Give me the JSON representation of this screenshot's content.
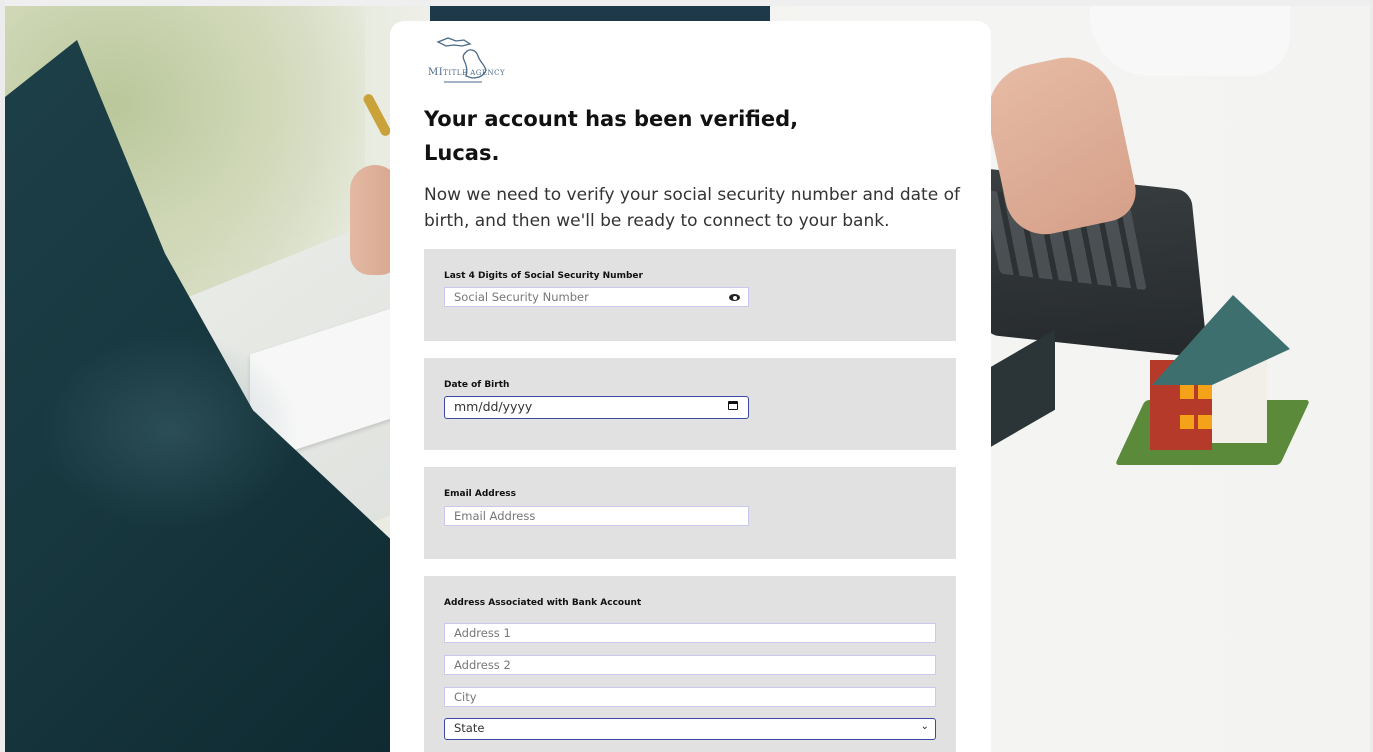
{
  "logo": {
    "name_main": "MI",
    "name_rest": "TITLE AGENCY"
  },
  "heading": {
    "line1": "Your account has been verified,",
    "line2": "Lucas."
  },
  "subtitle": "Now we need to verify your social security number and date of birth, and then we'll be ready to connect to your bank.",
  "ssn": {
    "label": "Last 4 Digits of Social Security Number",
    "placeholder": "Social Security Number",
    "toggle_icon": "eye-icon"
  },
  "dob": {
    "label": "Date of Birth",
    "placeholder": "mm/dd/yyyy",
    "icon": "calendar-icon"
  },
  "email": {
    "label": "Email Address",
    "placeholder": "Email Address"
  },
  "address": {
    "label": "Address Associated with Bank Account",
    "address1_placeholder": "Address 1",
    "address2_placeholder": "Address 2",
    "city_placeholder": "City",
    "state_selected": "State"
  },
  "colors": {
    "panel_bg": "#e1e1e1",
    "focus_border": "#3b4aa8",
    "input_border": "#c9c9ef",
    "logo_blue": "#4a6a8a"
  }
}
